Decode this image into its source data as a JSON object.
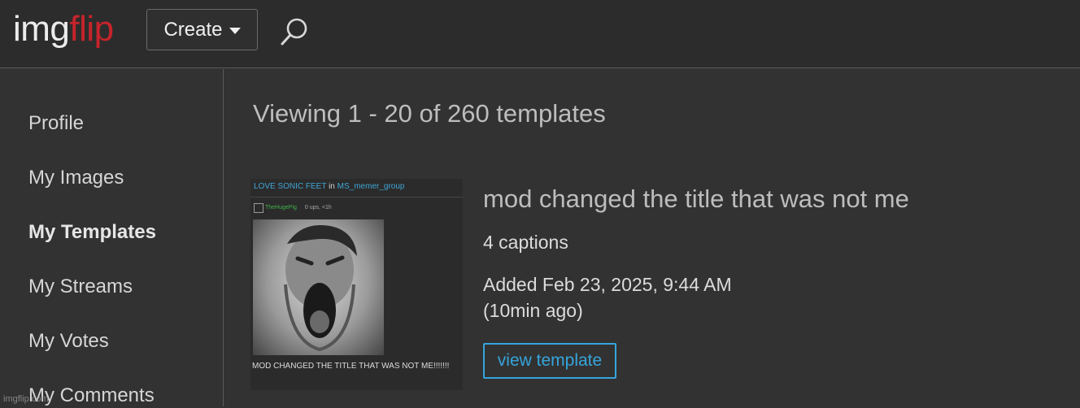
{
  "header": {
    "logo_part1": "img",
    "logo_part2": "flip",
    "create_label": "Create",
    "logo_colors": {
      "light": "#ececec",
      "red": "#c6242b"
    },
    "search_icon": "search-icon"
  },
  "sidebar": {
    "items": [
      {
        "label": "Profile",
        "active": false
      },
      {
        "label": "My Images",
        "active": false
      },
      {
        "label": "My Templates",
        "active": true
      },
      {
        "label": "My Streams",
        "active": false
      },
      {
        "label": "My Votes",
        "active": false
      },
      {
        "label": "My Comments",
        "active": false
      }
    ]
  },
  "main": {
    "viewing": "Viewing 1 - 20 of 260 templates",
    "template": {
      "title": "mod changed the title that was not me",
      "captions": "4 captions",
      "added": "Added Feb 23, 2025, 9:44 AM",
      "ago": "(10min ago)",
      "view_button": "view template",
      "thumbnail": {
        "post_title": "LOVE SONIC FEET",
        "in_word": "in",
        "stream": "MS_memer_group",
        "user": "TheHugePig",
        "meta": "0 ups, <1h",
        "caption": "MOD CHANGED THE TITLE THAT WAS NOT ME!!!!!!!"
      }
    }
  },
  "watermark": "imgflip.com",
  "colors": {
    "accent": "#35a5dc",
    "background": "#323232"
  }
}
